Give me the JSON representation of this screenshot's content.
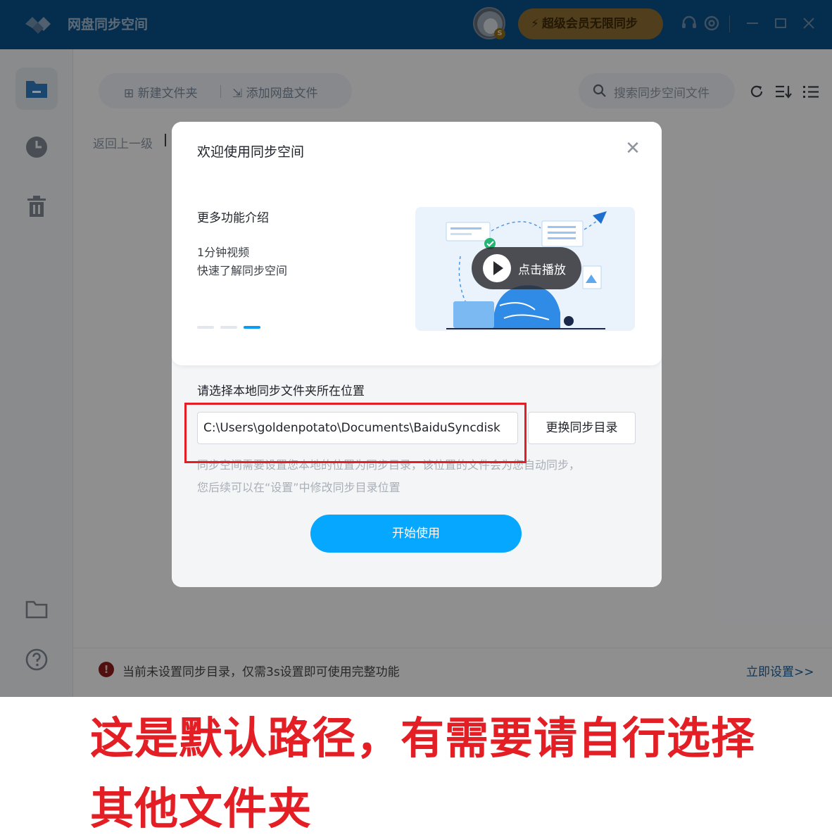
{
  "app": {
    "title": "网盘同步空间",
    "vip_label": "超级会员无限同步",
    "avatar_badge": "S"
  },
  "toolbar": {
    "new_folder": "新建文件夹",
    "add_cloud_file": "添加网盘文件",
    "search_placeholder": "搜索同步空间文件"
  },
  "breadcrumb": {
    "back": "返回上一级"
  },
  "status": {
    "warning": "当前未设置同步目录，仅需3s设置即可使用完整功能",
    "setup_link": "立即设置>>"
  },
  "dialog": {
    "title": "欢迎使用同步空间",
    "feature_title": "更多功能介绍",
    "feature_lines": [
      "1分钟视频",
      "快速了解同步空间"
    ],
    "play_label": "点击播放",
    "carousel_active_index": 2,
    "select_label": "请选择本地同步文件夹所在位置",
    "path_value": "C:\\Users\\goldenpotato\\Documents\\BaiduSyncdisk",
    "change_button": "更换同步目录",
    "hint_lines": [
      "同步空间需要设置您本地的位置为同步目录，该位置的文件会为您自动同步，",
      "您后续可以在“设置”中修改同步目录位置"
    ],
    "start_button": "开始使用"
  },
  "caption": {
    "line1": "这是默认路径，有需要请自行选择",
    "line2": "其他文件夹"
  },
  "colors": {
    "titlebar": "#0a4f86",
    "accent": "#06a7ff",
    "highlight": "#e31e24"
  }
}
